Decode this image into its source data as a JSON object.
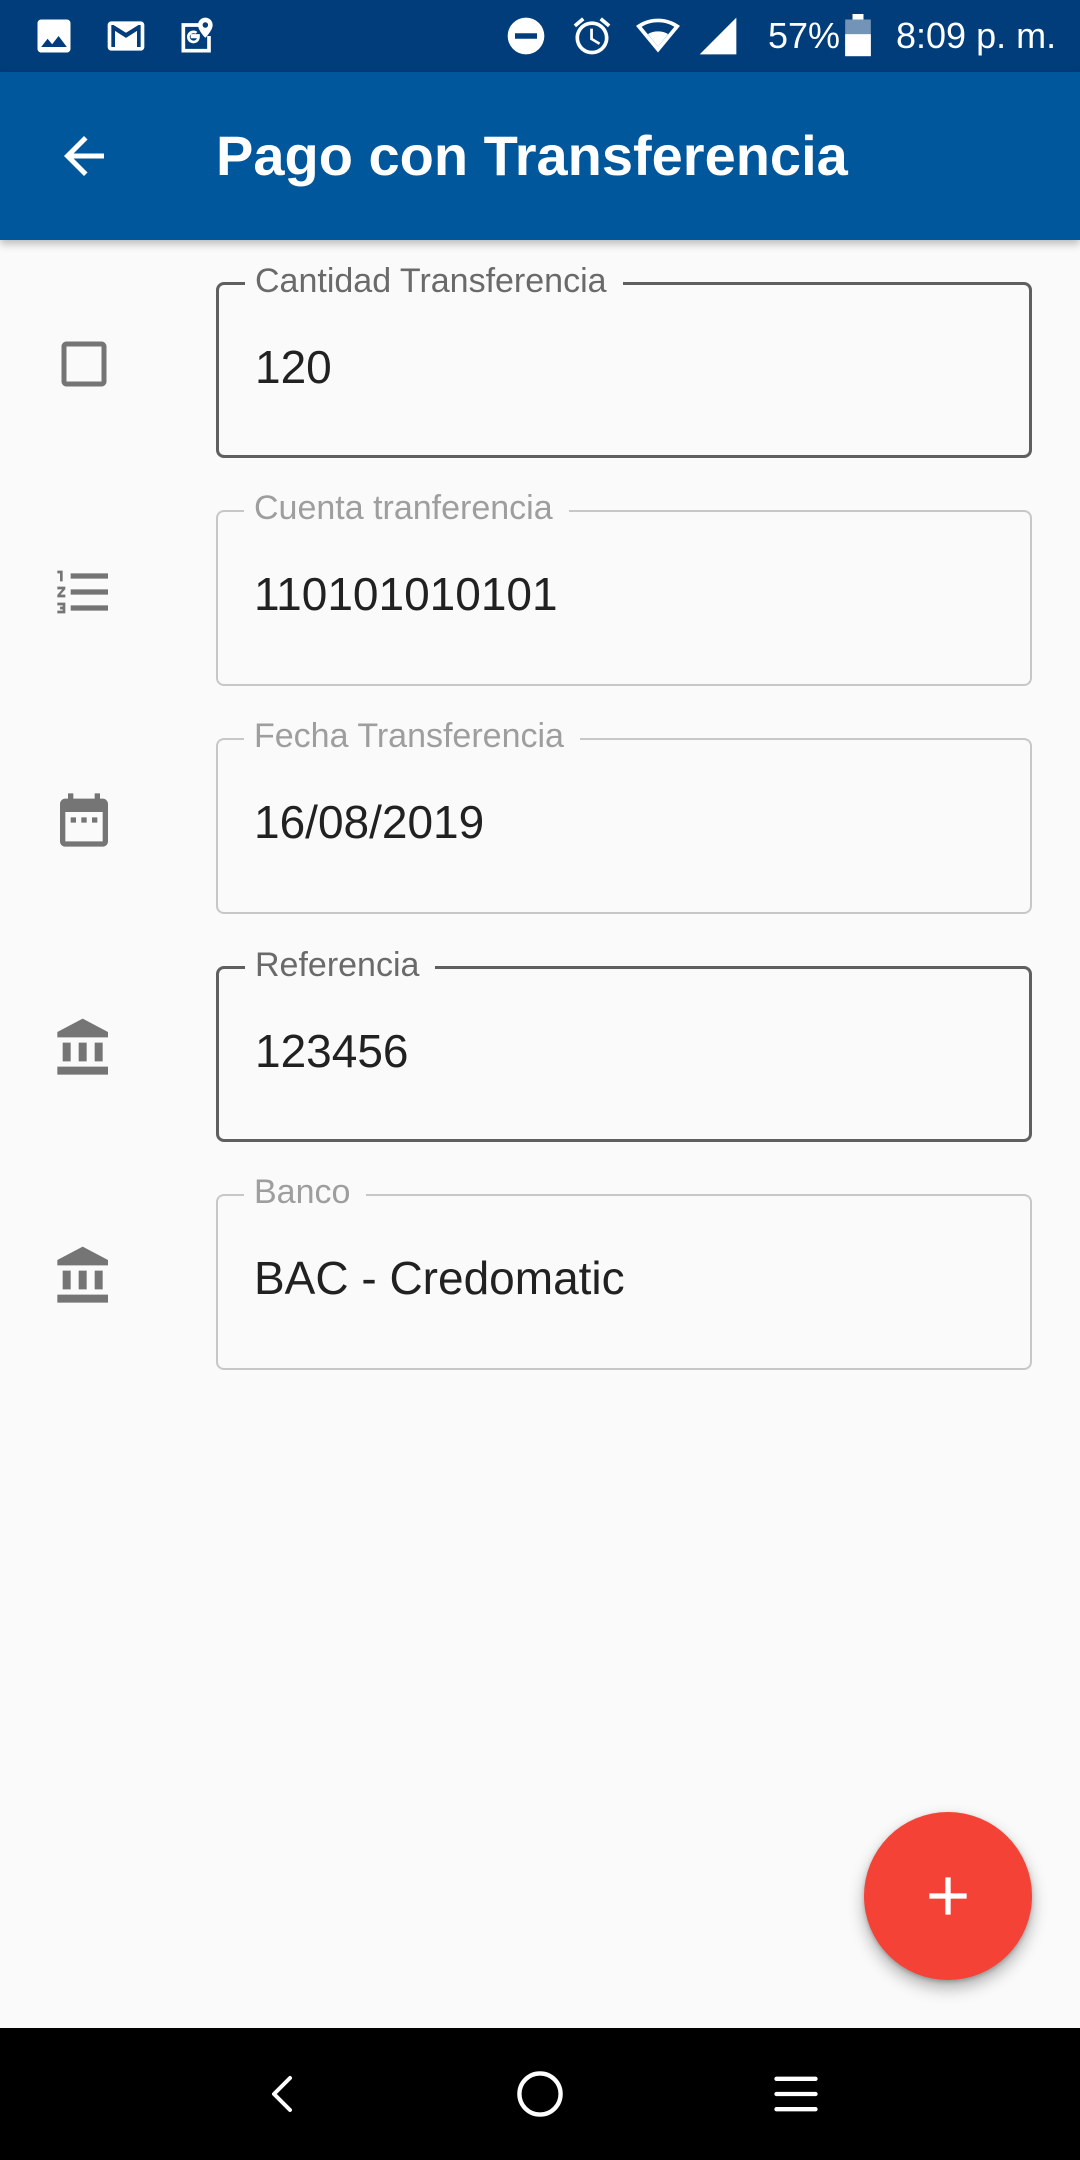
{
  "status_bar": {
    "icons_left": [
      "image-icon",
      "gmail-icon",
      "maps-icon"
    ],
    "icons_right": [
      "do-not-disturb-icon",
      "alarm-icon",
      "wifi-icon",
      "signal-icon"
    ],
    "battery": "57%",
    "time": "8:09 p. m."
  },
  "app_bar": {
    "title": "Pago con Transferencia",
    "back_icon": "arrow-back-icon"
  },
  "form": {
    "fields": [
      {
        "label": "Cantidad Transferencia",
        "value": "120",
        "icon": "checkbox-outline-icon",
        "focused": true
      },
      {
        "label": "Cuenta tranferencia",
        "value": "110101010101",
        "icon": "numbered-list-icon",
        "focused": false
      },
      {
        "label": "Fecha Transferencia",
        "value": "16/08/2019",
        "icon": "calendar-icon",
        "focused": false
      },
      {
        "label": "Referencia",
        "value": "123456",
        "icon": "bank-icon",
        "focused": true
      },
      {
        "label": "Banco",
        "value": "BAC - Credomatic",
        "icon": "bank-icon",
        "focused": false
      }
    ]
  },
  "fab": {
    "icon": "plus-icon",
    "color": "#f44336"
  },
  "nav_bar": {
    "buttons": [
      "nav-back-icon",
      "nav-home-icon",
      "nav-menu-icon"
    ]
  },
  "colors": {
    "status_bar": "#003d7a",
    "app_bar": "#01579b",
    "background": "#fafafa",
    "icon_gray": "#757575"
  }
}
